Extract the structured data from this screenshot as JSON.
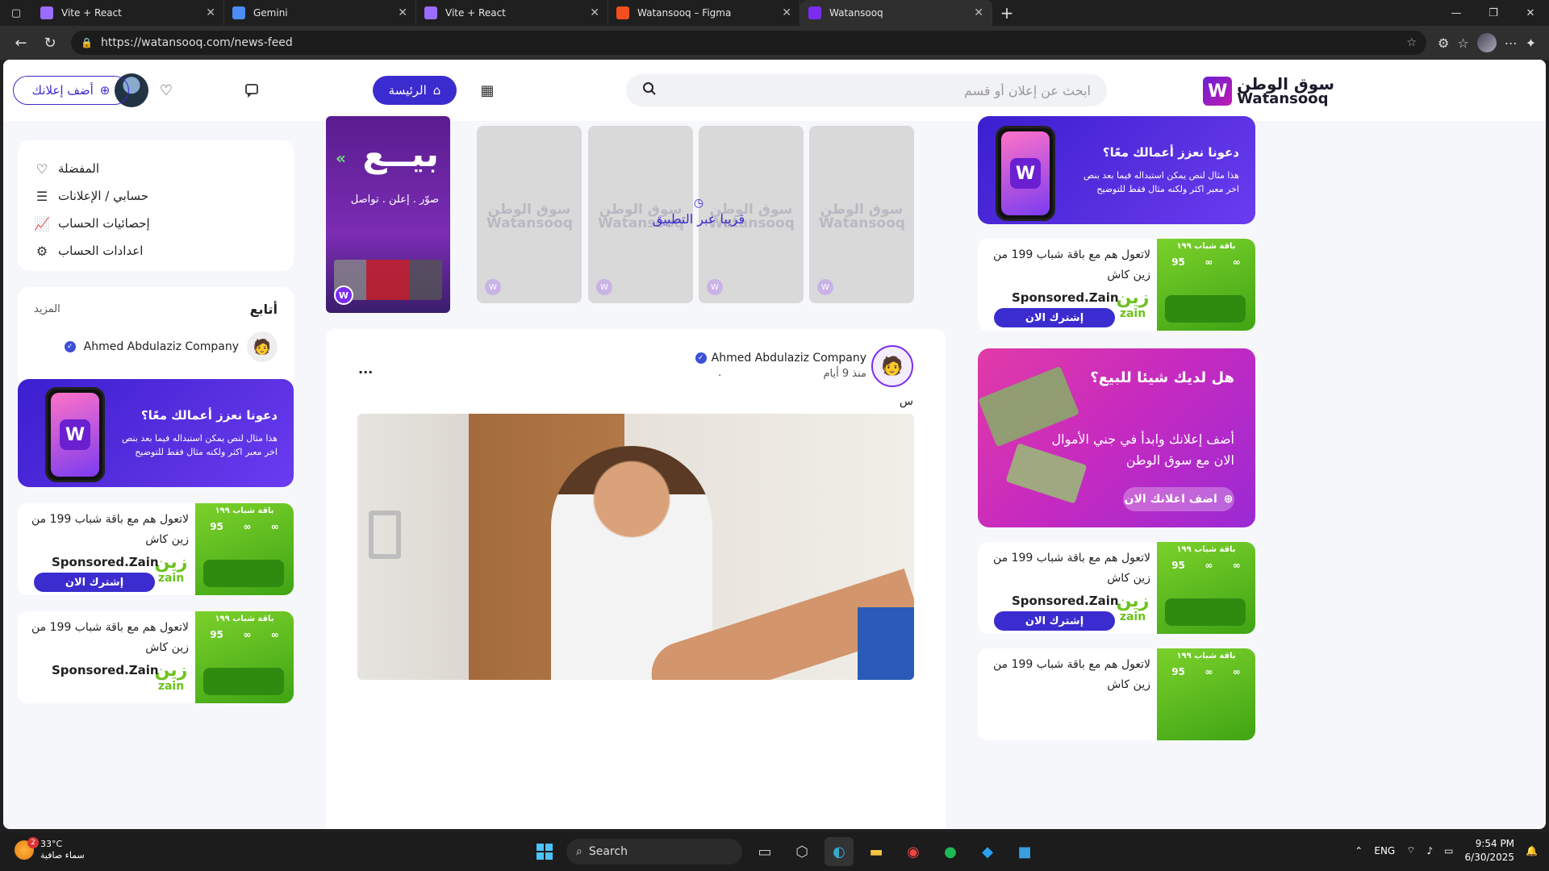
{
  "browser": {
    "tabs": [
      {
        "title": "Vite + React",
        "fav_color": "#9b6cff"
      },
      {
        "title": "Gemini",
        "fav_color": "#4c8df6"
      },
      {
        "title": "Vite + React",
        "fav_color": "#9b6cff"
      },
      {
        "title": "Watansooq – Figma",
        "fav_color": "#f24e1e"
      },
      {
        "title": "Watansooq",
        "fav_color": "#7b2cf0"
      }
    ],
    "url": "https://watansooq.com/news-feed"
  },
  "header": {
    "logo_ar": "سوق الوطن",
    "logo_en": "Watansooq",
    "search_placeholder": "ابحث عن إعلان أو قسم",
    "home_label": "الرئيسة",
    "add_ad_label": "أضف إعلانك"
  },
  "sidebar": {
    "menu": [
      {
        "label": "المفضلة",
        "icon": "heart-icon"
      },
      {
        "label": "حسابي / الإعلانات",
        "icon": "list-icon"
      },
      {
        "label": "إحصائيات الحساب",
        "icon": "chart-icon"
      },
      {
        "label": "اعدادات الحساب",
        "icon": "gear-icon"
      }
    ],
    "follow": {
      "title": "أتابع",
      "more": "المزيد",
      "company": "Ahmed Abdulaziz Company"
    }
  },
  "promo": {
    "title": "دعونا نعزز أعمالك معًا؟",
    "text": "هذا مثال لنص يمكن استبداله فيما بعد بنص اخر معبر اكثر ولكنه مثال فقط للتوضيح"
  },
  "sponsor": {
    "text": "لاتعول هم مع باقة شباب 199 من زين كاش",
    "sponsored": "Sponsored.",
    "brand": "Zain",
    "subscribe": "إشترك الان",
    "zain_ar": "زين",
    "zain_en": "zain",
    "banner_title": "باقة شباب ١٩٩",
    "banner_n1": "95",
    "banner_n2": "∞",
    "banner_n3": "∞"
  },
  "stories": {
    "sale_word": "بيــع",
    "sale_sub": "صوّر . إعلن . تواصل",
    "watermark_ar": "سوق الوطن",
    "watermark_en": "Watansooq",
    "coming_soon": "قريبا عبر التطبيق"
  },
  "post": {
    "author": "Ahmed Abdulaziz Company",
    "time": "منذ 9 أيام",
    "caption": "س",
    "more": "...",
    "dot": "."
  },
  "sale_banner": {
    "title": "هل لديك شيئا للبيع؟",
    "text": "أضف إعلانك وابدأ في جني الأموال الان مع سوق الوطن",
    "button": "اضف اعلانك الان"
  },
  "taskbar": {
    "temp": "33°C",
    "weather": "سماء صافية",
    "badge": "2",
    "search": "Search",
    "lang": "ENG",
    "time": "9:54 PM",
    "date": "6/30/2025"
  }
}
